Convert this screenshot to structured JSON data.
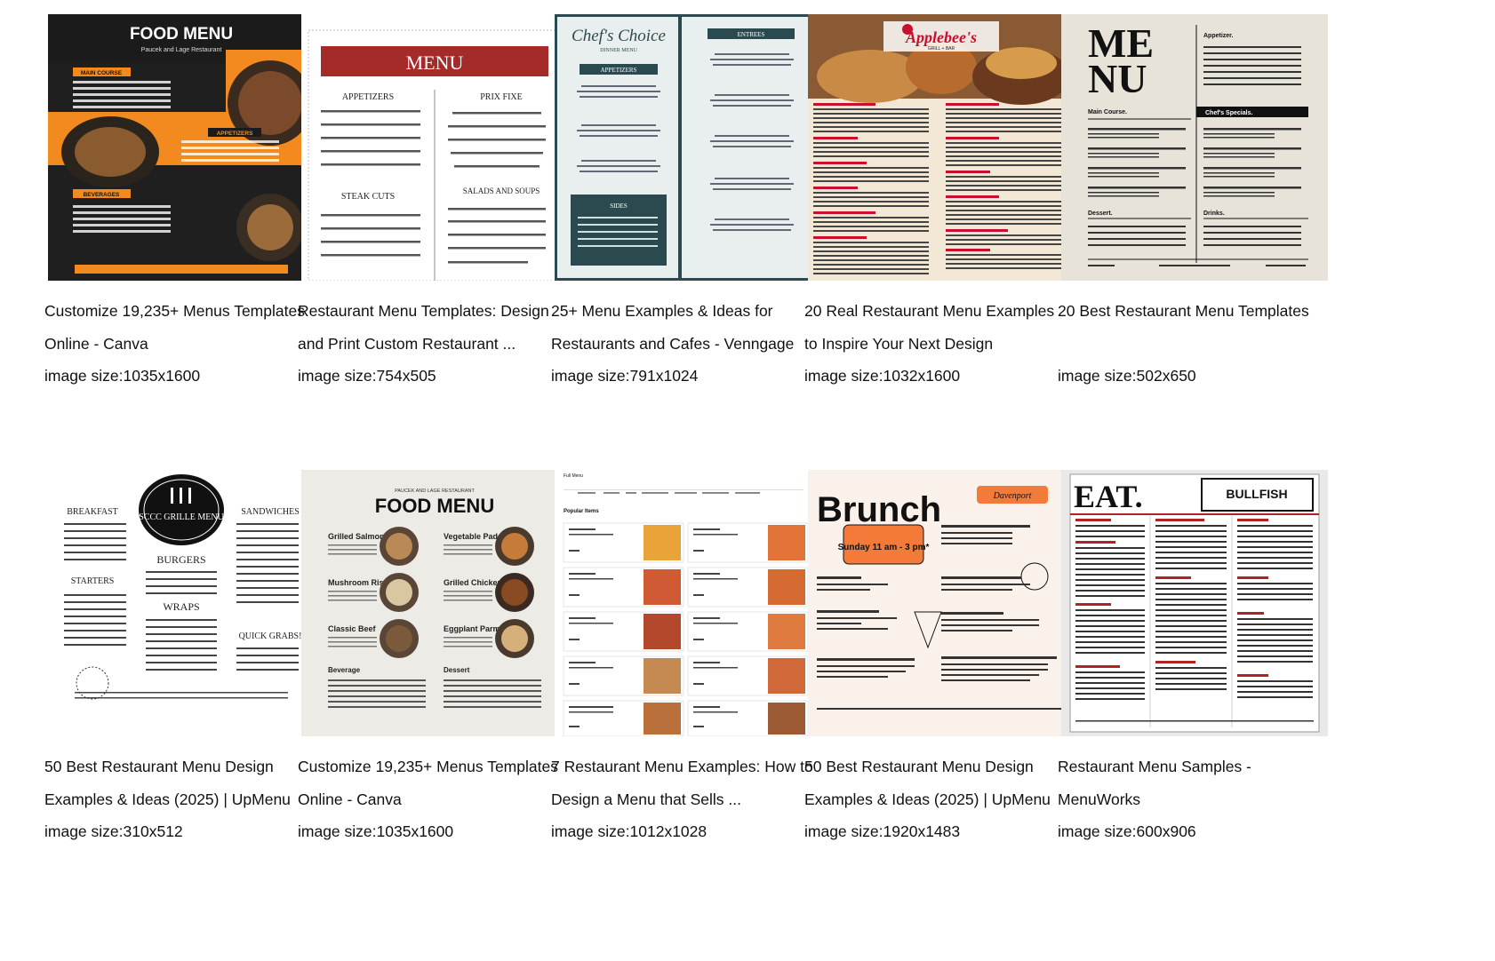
{
  "results": [
    {
      "title_line1": "Customize 19,235+ Menus Templates",
      "title_line2": "Online - Canva",
      "size_label": "image size:1035x1600",
      "thumb": {
        "heading": "FOOD MENU",
        "subheading": "Paucek and Lage Restaurant",
        "section1": "MAIN COURSE",
        "section2": "APPETIZERS",
        "section3": "BEVERAGES",
        "accent": "#f28a1f",
        "bg": "#1b1b1b"
      }
    },
    {
      "title_line1": "Restaurant Menu Templates: Design",
      "title_line2": "and Print Custom Restaurant ...",
      "size_label": "image size:754x505",
      "thumb": {
        "heading": "MENU",
        "col1": "APPETIZERS",
        "col2": "PRIX FIXE",
        "col3": "STEAK CUTS",
        "col4": "SALADS AND SOUPS",
        "accent": "#a52a2a"
      }
    },
    {
      "title_line1": "25+ Menu Examples & Ideas for",
      "title_line2": "Restaurants and Cafes - Venngage",
      "size_label": "image size:791x1024",
      "thumb": {
        "heading": "Chef's Choice",
        "subheading": "DINNER MENU",
        "sec1": "APPETIZERS",
        "sec2": "ENTREES",
        "sec3": "SIDES",
        "accent": "#2b4a50",
        "bg": "#e9eeee"
      }
    },
    {
      "title_line1": "20 Real Restaurant Menu Examples",
      "title_line2": "to Inspire Your Next Design",
      "size_label": "image size:1032x1600",
      "thumb": {
        "heading": "Applebee's",
        "subheading": "GRILL + BAR",
        "accent": "#c8102e",
        "bg": "#f3e7d6"
      }
    },
    {
      "title_line1": "20 Best Restaurant Menu Templates",
      "title_line2": "",
      "size_label": "image size:502x650",
      "thumb": {
        "heading1": "ME",
        "heading2": "NU",
        "sec1": "Main Course.",
        "sec2": "Chef's Specials.",
        "sec3": "Dessert.",
        "sec4": "Drinks.",
        "sec5": "Appetizer.",
        "bg": "#e8e3d9"
      }
    },
    {
      "title_line1": "50 Best Restaurant Menu Design",
      "title_line2": "Examples & Ideas (2025) | UpMenu",
      "size_label": "image size:310x512",
      "thumb": {
        "heading": "SCCC GRILLE MENU",
        "sec1": "BREAKFAST",
        "sec2": "SANDWICHES",
        "sec3": "BURGERS",
        "sec4": "STARTERS",
        "sec5": "WRAPS",
        "sec6": "QUICK GRABS!"
      }
    },
    {
      "title_line1": "Customize 19,235+ Menus Templates",
      "title_line2": "Online - Canva",
      "size_label": "image size:1035x1600",
      "thumb": {
        "heading": "FOOD MENU",
        "subheading": "PAUCEK AND LAGE RESTAURANT",
        "item1": "Grilled Salmon",
        "item2": "Vegetable Pad Thai",
        "item3": "Mushroom Risotto",
        "item4": "Grilled Chicken",
        "item5": "Classic Beef",
        "item6": "Eggplant Parmesan",
        "sec1": "Beverage",
        "sec2": "Dessert",
        "bg": "#ecebe6"
      }
    },
    {
      "title_line1": "7 Restaurant Menu Examples: How to",
      "title_line2": "Design a Menu that Sells ...",
      "size_label": "image size:1012x1028",
      "thumb": {
        "heading": "Popular Items",
        "top": "Full Menu"
      }
    },
    {
      "title_line1": "50 Best Restaurant Menu Design",
      "title_line2": "Examples & Ideas (2025) | UpMenu",
      "size_label": "image size:1920x1483",
      "thumb": {
        "heading": "Brunch",
        "badge": "Sunday 11 am - 3 pm*",
        "logo": "Davenport",
        "bg": "#faf1ea",
        "accent": "#f47a3a"
      }
    },
    {
      "title_line1": "Restaurant Menu Samples -",
      "title_line2": "MenuWorks",
      "size_label": "image size:600x906",
      "thumb": {
        "heading": "EAT.",
        "logo": "BULLFISH",
        "accent": "#b22222"
      }
    }
  ]
}
